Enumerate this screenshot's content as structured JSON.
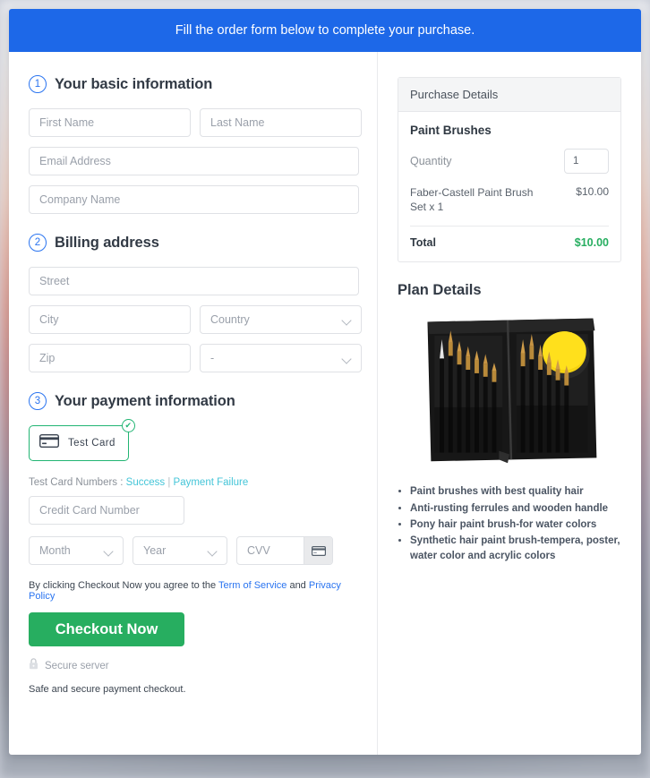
{
  "banner": {
    "text": "Fill the order form below to complete your purchase."
  },
  "sections": {
    "basic": {
      "number": "1",
      "title": "Your basic information",
      "fields": {
        "first_name": "First Name",
        "last_name": "Last Name",
        "email": "Email Address",
        "company": "Company Name"
      }
    },
    "billing": {
      "number": "2",
      "title": "Billing address",
      "fields": {
        "street": "Street",
        "city": "City",
        "country": "Country",
        "zip": "Zip",
        "state": "-"
      }
    },
    "payment": {
      "number": "3",
      "title": "Your payment information",
      "tab_label": "Test  Card",
      "tab_icon": "credit-card-icon",
      "check_icon": "check-circle-icon",
      "test_numbers_label": "Test Card Numbers :",
      "link_success": "Success",
      "link_separator": "|",
      "link_failure": "Payment Failure",
      "fields": {
        "card_number": "Credit Card Number",
        "month": "Month",
        "year": "Year",
        "cvv": "CVV"
      },
      "cvv_icon": "credit-card-icon"
    }
  },
  "terms": {
    "prefix": "By clicking Checkout Now you agree to the ",
    "link_tos": "Term of Service",
    "middle": " and ",
    "link_privacy": "Privacy Policy"
  },
  "checkout": {
    "button_label": "Checkout Now",
    "lock_icon": "lock-icon",
    "secure_text": "Secure server",
    "safe_text": "Safe and secure payment checkout."
  },
  "purchase_details": {
    "header": "Purchase Details",
    "product_name": "Paint Brushes",
    "quantity_label": "Quantity",
    "quantity_value": "1",
    "line_item_desc": "Faber-Castell Paint Brush Set x 1",
    "line_item_amount": "$10.00",
    "total_label": "Total",
    "total_amount": "$10.00"
  },
  "plan_details": {
    "title": "Plan Details",
    "image_alt": "paint-brush-set-case-photo",
    "features": [
      "Paint brushes with best quality hair",
      "Anti-rusting ferrules and wooden handle",
      "Pony hair paint brush-for water colors",
      "Synthetic hair paint brush-tempera, poster, water color and acrylic colors"
    ]
  },
  "colors": {
    "banner_blue": "#1d68e8",
    "accent_blue": "#2a74f0",
    "success_green": "#27ae60",
    "tab_green": "#22b573",
    "link_cyan": "#44c5d8"
  }
}
